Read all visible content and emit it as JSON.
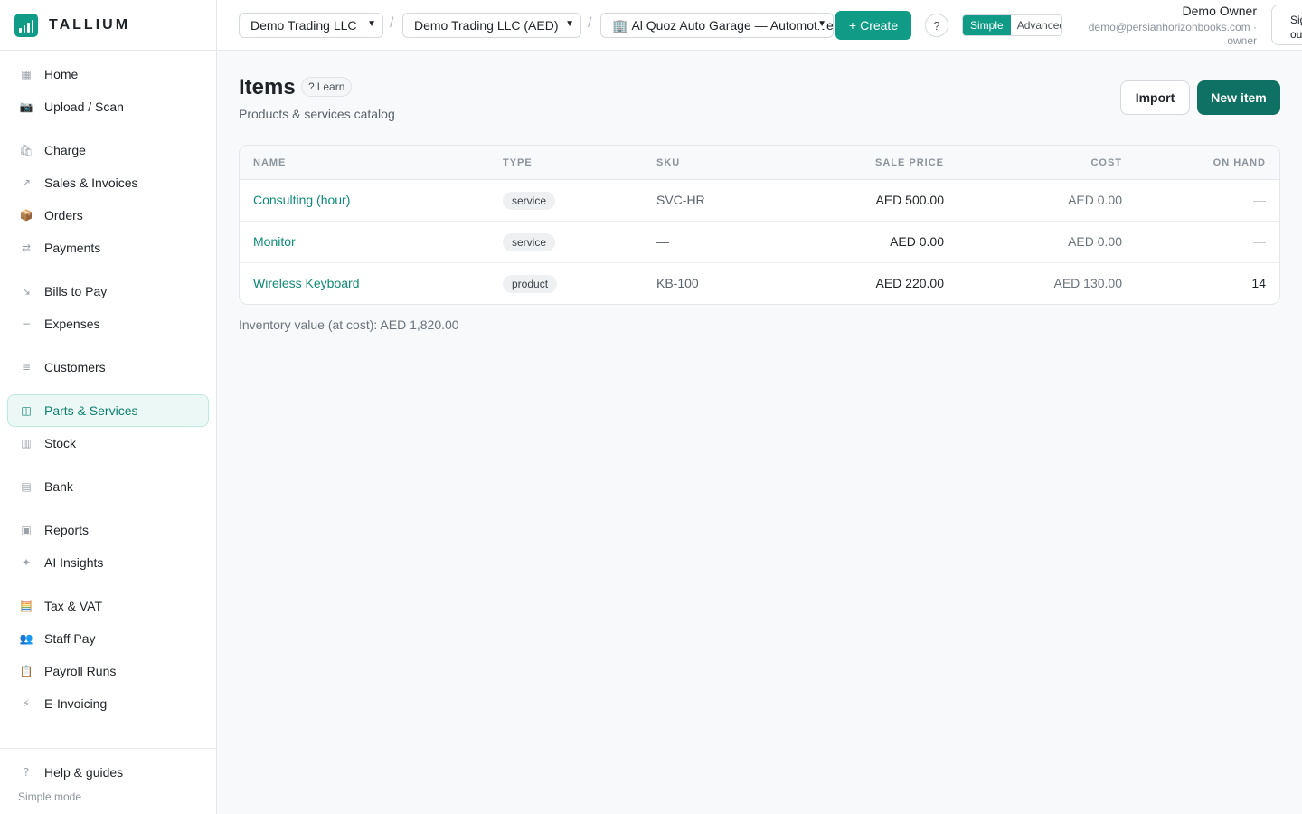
{
  "brand": {
    "name": "TALLIUM"
  },
  "sidebar": {
    "items": [
      {
        "label": "Home",
        "icon": "grid-icon",
        "glyph": "▦"
      },
      {
        "label": "Upload / Scan",
        "icon": "camera-icon",
        "glyph": "📷"
      },
      {
        "label": "Charge",
        "icon": "shopping-bag-icon",
        "glyph": "🛍"
      },
      {
        "label": "Sales & Invoices",
        "icon": "arrow-up-right-icon",
        "glyph": "↗"
      },
      {
        "label": "Orders",
        "icon": "package-icon",
        "glyph": "📦"
      },
      {
        "label": "Payments",
        "icon": "transfer-icon",
        "glyph": "⇄"
      },
      {
        "label": "Bills to Pay",
        "icon": "arrow-down-right-icon",
        "glyph": "↘"
      },
      {
        "label": "Expenses",
        "icon": "minus-icon",
        "glyph": "−"
      },
      {
        "label": "Customers",
        "icon": "list-icon",
        "glyph": "≡"
      },
      {
        "label": "Parts & Services",
        "icon": "columns-icon",
        "glyph": "◫"
      },
      {
        "label": "Stock",
        "icon": "bars-icon",
        "glyph": "▥"
      },
      {
        "label": "Bank",
        "icon": "bank-icon",
        "glyph": "▤"
      },
      {
        "label": "Reports",
        "icon": "report-icon",
        "glyph": "▣"
      },
      {
        "label": "AI Insights",
        "icon": "sparkle-icon",
        "glyph": "✦"
      },
      {
        "label": "Tax & VAT",
        "icon": "abacus-icon",
        "glyph": "🧮"
      },
      {
        "label": "Staff Pay",
        "icon": "people-icon",
        "glyph": "👥"
      },
      {
        "label": "Payroll Runs",
        "icon": "clipboard-icon",
        "glyph": "📋"
      },
      {
        "label": "E-Invoicing",
        "icon": "lightning-icon",
        "glyph": "⚡"
      }
    ],
    "footer": {
      "help_label": "Help & guides",
      "help_glyph": "?",
      "mode_text": "Simple mode"
    }
  },
  "topbar": {
    "company_select": "Demo Trading LLC",
    "book_select": "Demo Trading LLC (AED)",
    "workspace_glyph": "🏢",
    "workspace_select": "Al Quoz Auto Garage — Automotive",
    "create_label": "Create",
    "help_label": "?",
    "mode_simple": "Simple",
    "mode_advanced": "Advanced",
    "user_name": "Demo Owner",
    "user_email": "demo@persianhorizonbooks.com ·",
    "user_role": "owner",
    "signout_label": "Sign out"
  },
  "main": {
    "title": "Items",
    "learn_label": "Learn",
    "subtitle": "Products & services catalog",
    "import_label": "Import",
    "new_label": "New item",
    "table": {
      "headers": [
        "NAME",
        "TYPE",
        "SKU",
        "SALE PRICE",
        "COST",
        "ON HAND"
      ],
      "rows": [
        {
          "name": "Consulting (hour)",
          "type": "service",
          "sku": "SVC-HR",
          "sale": "AED 500.00",
          "cost": "AED 0.00",
          "on_hand": "—"
        },
        {
          "name": "Monitor",
          "type": "service",
          "sku": "—",
          "sale": "AED 0.00",
          "cost": "AED 0.00",
          "on_hand": "—"
        },
        {
          "name": "Wireless Keyboard",
          "type": "product",
          "sku": "KB-100",
          "sale": "AED 220.00",
          "cost": "AED 130.00",
          "on_hand": "14"
        }
      ]
    },
    "inventory_note": "Inventory value (at cost): AED 1,820.00"
  },
  "colors": {
    "accent": "#0f9b85",
    "accent_dark": "#0e7163",
    "link": "#0f8a76"
  }
}
